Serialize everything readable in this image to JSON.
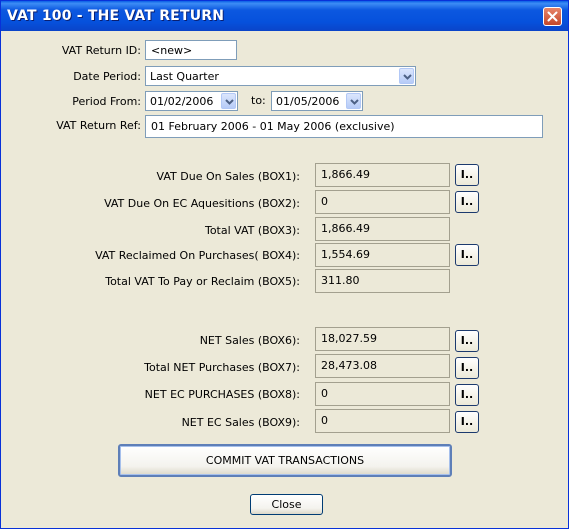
{
  "window": {
    "title": "VAT 100 - THE VAT RETURN",
    "close_icon": "close-icon"
  },
  "header": {
    "vat_return_id": {
      "label": "VAT Return ID:",
      "value": "<new>"
    },
    "date_period": {
      "label": "Date Period:",
      "value": "Last Quarter"
    },
    "period_from": {
      "label": "Period From:",
      "value": "01/02/2006"
    },
    "period_to": {
      "label": "to:",
      "value": "01/05/2006"
    },
    "vat_return_ref": {
      "label": "VAT Return Ref:",
      "value": "01 February 2006 - 01 May 2006 (exclusive)"
    }
  },
  "boxes": [
    {
      "label": "VAT Due On Sales (BOX1):",
      "value": "1,866.49",
      "button": "I.."
    },
    {
      "label": "VAT Due On EC Aquesitions (BOX2):",
      "value": "0",
      "button": "I.."
    },
    {
      "label": "Total VAT (BOX3):",
      "value": "1,866.49",
      "button": ""
    },
    {
      "label": "VAT Reclaimed On Purchases( BOX4):",
      "value": "1,554.69",
      "button": "I.."
    },
    {
      "label": "Total VAT To Pay or Reclaim (BOX5):",
      "value": "311.80",
      "button": ""
    },
    {
      "label": "NET Sales (BOX6):",
      "value": "18,027.59",
      "button": "I.."
    },
    {
      "label": "Total NET Purchases (BOX7):",
      "value": "28,473.08",
      "button": "I.."
    },
    {
      "label": "NET EC PURCHASES (BOX8):",
      "value": "0",
      "button": "I.."
    },
    {
      "label": "NET EC Sales (BOX9):",
      "value": "0",
      "button": "I.."
    }
  ],
  "actions": {
    "commit_label": "COMMIT VAT TRANSACTIONS",
    "close_label": "Close"
  }
}
